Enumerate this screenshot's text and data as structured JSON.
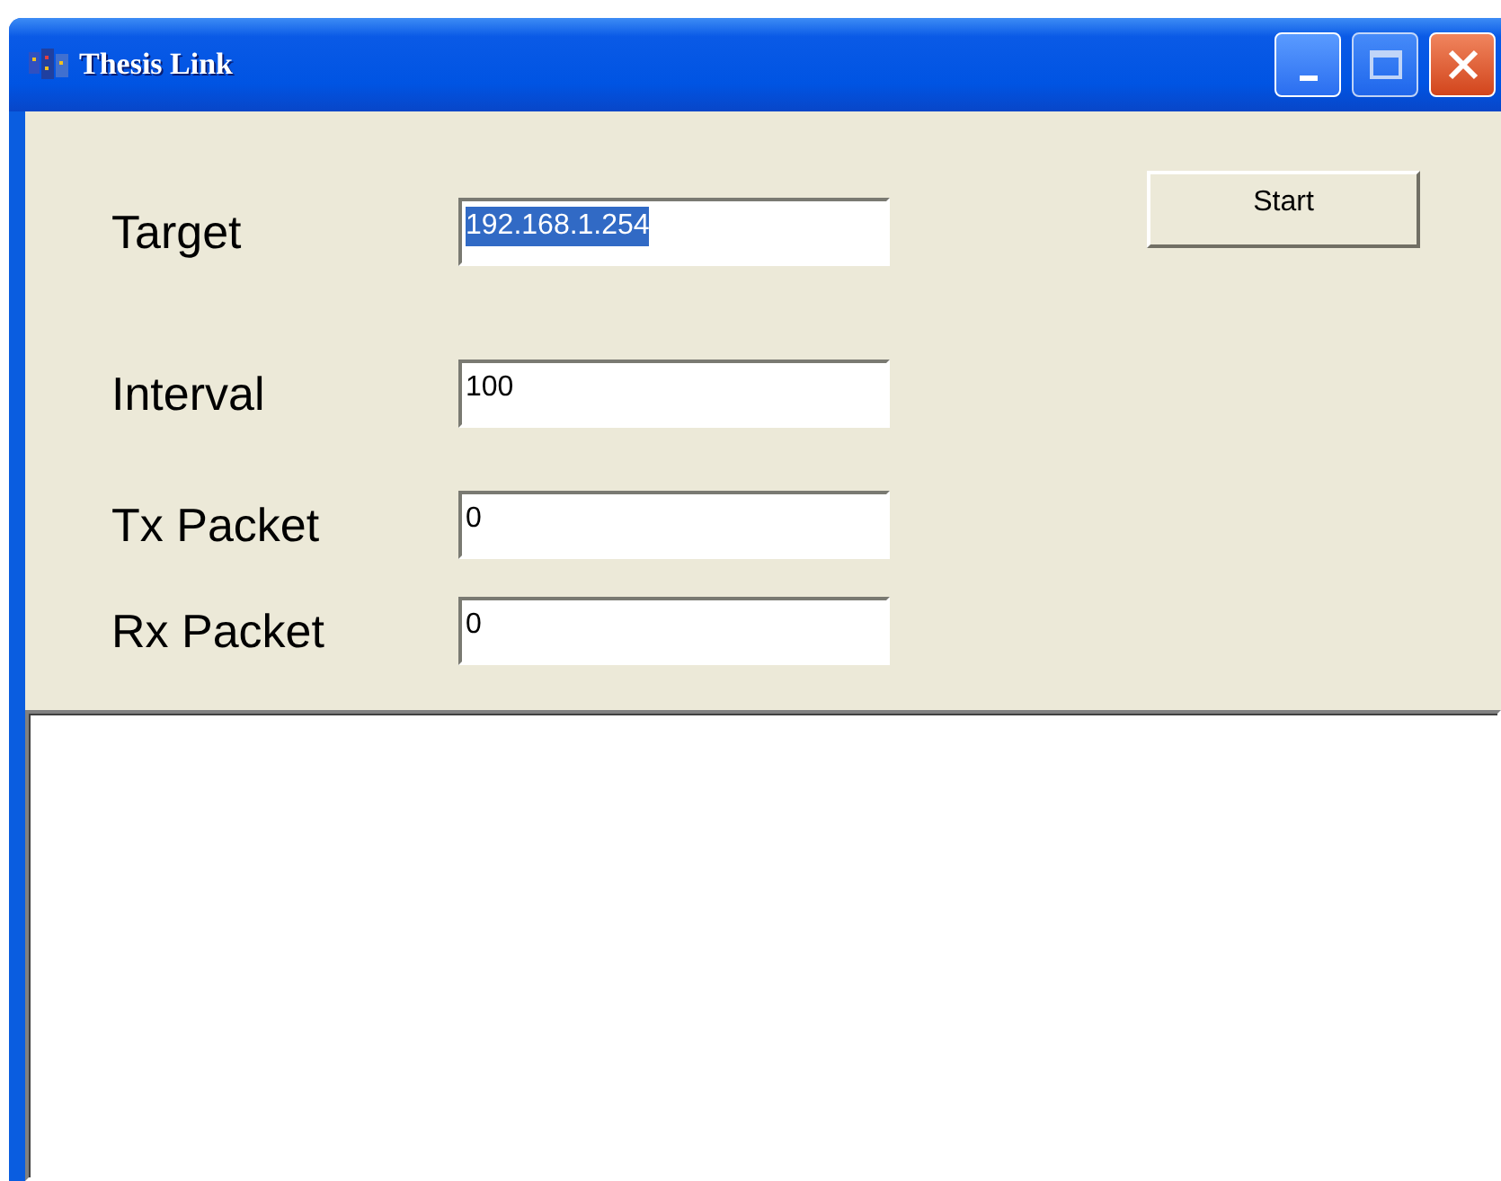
{
  "window": {
    "title": "Thesis Link"
  },
  "fields": [
    {
      "label": "Target",
      "value": "192.168.1.254",
      "selected": true
    },
    {
      "label": "Interval",
      "value": "100",
      "selected": false
    },
    {
      "label": "Tx Packet",
      "value": "0",
      "selected": false
    },
    {
      "label": "Rx Packet",
      "value": "0",
      "selected": false
    }
  ],
  "buttons": [
    {
      "label": "Start"
    }
  ]
}
